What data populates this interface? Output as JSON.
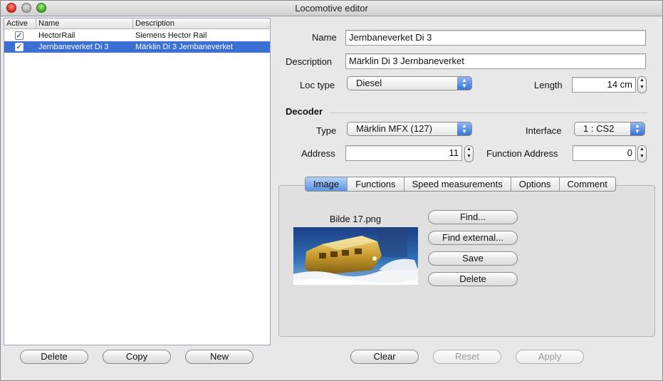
{
  "window": {
    "title": "Locomotive editor"
  },
  "table": {
    "columns": [
      "Active",
      "Name",
      "Description"
    ],
    "rows": [
      {
        "active": true,
        "name": "HectorRail",
        "description": "Siemens Hector Rail",
        "selected": false
      },
      {
        "active": true,
        "name": "Jernbaneverket Di 3",
        "description": "Märklin Di 3 Jernbaneverket",
        "selected": true
      }
    ],
    "check_glyph": "✓"
  },
  "left_buttons": {
    "delete": "Delete",
    "copy": "Copy",
    "new": "New"
  },
  "form": {
    "name_label": "Name",
    "name_value": "Jernbaneverket Di 3",
    "description_label": "Description",
    "description_value": "Märklin Di 3 Jernbaneverket",
    "loc_type_label": "Loc type",
    "loc_type_value": "Diesel",
    "length_label": "Length",
    "length_value": "14 cm"
  },
  "decoder": {
    "title": "Decoder",
    "type_label": "Type",
    "type_value": "Märklin MFX (127)",
    "interface_label": "Interface",
    "interface_value": "1 : CS2",
    "address_label": "Address",
    "address_value": "11",
    "function_address_label": "Function Address",
    "function_address_value": "0"
  },
  "tabs": [
    "Image",
    "Functions",
    "Speed measurements",
    "Options",
    "Comment"
  ],
  "active_tab": "Image",
  "image_tab": {
    "filename": "Bilde 17.png",
    "find": "Find...",
    "find_external": "Find external...",
    "save": "Save",
    "delete": "Delete"
  },
  "bottom_buttons": {
    "clear": "Clear",
    "reset": "Reset",
    "apply": "Apply"
  },
  "colors": {
    "selection": "#3b6fd4",
    "accent": "#3a74d6"
  }
}
